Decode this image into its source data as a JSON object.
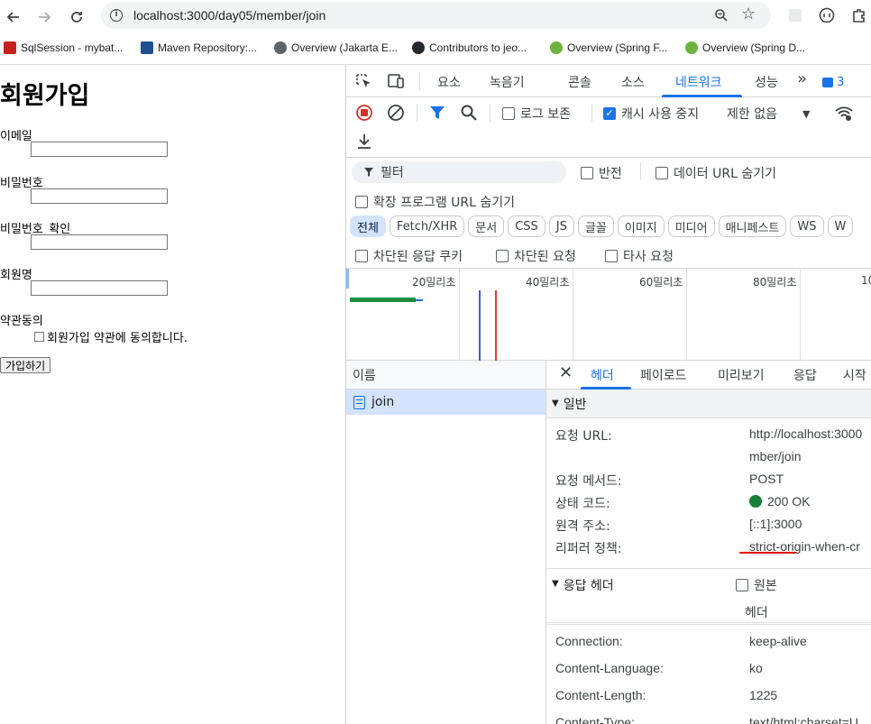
{
  "browser": {
    "url": "localhost:3000/day05/member/join",
    "bookmarks": [
      {
        "label": "SqlSession - mybat...",
        "color": "#c5221f"
      },
      {
        "label": "Maven Repository:...",
        "color": "#1e4f91"
      },
      {
        "label": "Overview (Jakarta E...",
        "color": "#5f6368"
      },
      {
        "label": "Contributors to jeo...",
        "color": "#24292f"
      },
      {
        "label": "Overview (Spring F...",
        "color": "#6db33f"
      },
      {
        "label": "Overview (Spring D...",
        "color": "#6db33f"
      }
    ]
  },
  "page": {
    "title": "회원가입",
    "labels": {
      "email": "이메일",
      "password": "비밀번호",
      "password_confirm": "비밀번호_확인",
      "name": "회원명",
      "terms": "약관동의"
    },
    "agree_text": "회원가입 약관에 동의합니다.",
    "submit_label": "가입하기"
  },
  "devtools": {
    "tabs": [
      "요소",
      "녹음기",
      "콘솔",
      "소스",
      "네트워크",
      "성능"
    ],
    "active_tab": "네트워크",
    "more": "»",
    "message_count": "3",
    "toolbar": {
      "preserve_log": "로그 보존",
      "disable_cache": "캐시 사용 중지",
      "throttling": "제한 없음"
    },
    "filter": {
      "placeholder": "필터",
      "invert": "반전",
      "hide_data_urls": "데이터 URL 숨기기",
      "hide_extension_urls": "확장 프로그램 URL 숨기기"
    },
    "chips": [
      "전체",
      "Fetch/XHR",
      "문서",
      "CSS",
      "JS",
      "글꼴",
      "이미지",
      "미디어",
      "매니페스트",
      "WS",
      "W"
    ],
    "blocked": {
      "blocked_cookies": "차단된 응답 쿠키",
      "blocked_requests": "차단된 요청",
      "third_party": "타사 요청"
    },
    "timeline_labels": [
      "20밀리초",
      "40밀리초",
      "60밀리초",
      "80밀리초",
      "10"
    ],
    "name_column": "이름",
    "request": "join",
    "detail_tabs": [
      "헤더",
      "페이로드",
      "미리보기",
      "응답",
      "시작"
    ],
    "general": {
      "title": "일반",
      "request_url_key": "요청 URL:",
      "request_url_line1": "http://localhost:3000",
      "request_url_line2": "mber/join",
      "method_key": "요청 메서드:",
      "method_val": "POST",
      "status_key": "상태 코드:",
      "status_val": "200 OK",
      "remote_key": "원격 주소:",
      "remote_val": "[::1]:3000",
      "referrer_key": "리퍼러 정책:",
      "referrer_val": "strict-origin-when-cr"
    },
    "response_headers": {
      "title": "응답 헤더",
      "raw_label": "원본",
      "header_col": "헤더",
      "rows": [
        {
          "key": "Connection:",
          "val": "keep-alive"
        },
        {
          "key": "Content-Language:",
          "val": "ko"
        },
        {
          "key": "Content-Length:",
          "val": "1225"
        },
        {
          "key": "Content-Type:",
          "val": "text/html;charset=U"
        }
      ]
    }
  }
}
